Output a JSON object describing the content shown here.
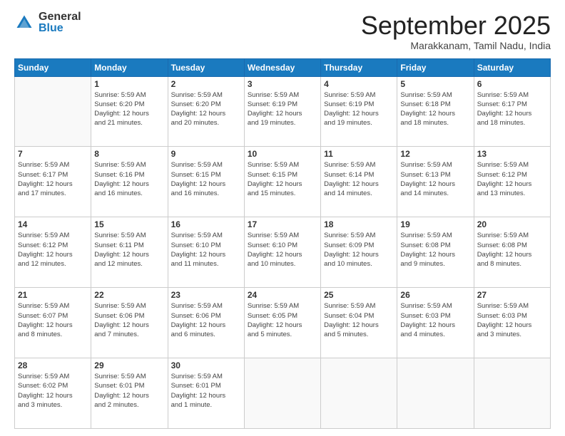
{
  "logo": {
    "general": "General",
    "blue": "Blue"
  },
  "header": {
    "month": "September 2025",
    "location": "Marakkanam, Tamil Nadu, India"
  },
  "weekdays": [
    "Sunday",
    "Monday",
    "Tuesday",
    "Wednesday",
    "Thursday",
    "Friday",
    "Saturday"
  ],
  "weeks": [
    [
      {
        "day": "",
        "info": ""
      },
      {
        "day": "1",
        "info": "Sunrise: 5:59 AM\nSunset: 6:20 PM\nDaylight: 12 hours\nand 21 minutes."
      },
      {
        "day": "2",
        "info": "Sunrise: 5:59 AM\nSunset: 6:20 PM\nDaylight: 12 hours\nand 20 minutes."
      },
      {
        "day": "3",
        "info": "Sunrise: 5:59 AM\nSunset: 6:19 PM\nDaylight: 12 hours\nand 19 minutes."
      },
      {
        "day": "4",
        "info": "Sunrise: 5:59 AM\nSunset: 6:19 PM\nDaylight: 12 hours\nand 19 minutes."
      },
      {
        "day": "5",
        "info": "Sunrise: 5:59 AM\nSunset: 6:18 PM\nDaylight: 12 hours\nand 18 minutes."
      },
      {
        "day": "6",
        "info": "Sunrise: 5:59 AM\nSunset: 6:17 PM\nDaylight: 12 hours\nand 18 minutes."
      }
    ],
    [
      {
        "day": "7",
        "info": "Sunrise: 5:59 AM\nSunset: 6:17 PM\nDaylight: 12 hours\nand 17 minutes."
      },
      {
        "day": "8",
        "info": "Sunrise: 5:59 AM\nSunset: 6:16 PM\nDaylight: 12 hours\nand 16 minutes."
      },
      {
        "day": "9",
        "info": "Sunrise: 5:59 AM\nSunset: 6:15 PM\nDaylight: 12 hours\nand 16 minutes."
      },
      {
        "day": "10",
        "info": "Sunrise: 5:59 AM\nSunset: 6:15 PM\nDaylight: 12 hours\nand 15 minutes."
      },
      {
        "day": "11",
        "info": "Sunrise: 5:59 AM\nSunset: 6:14 PM\nDaylight: 12 hours\nand 14 minutes."
      },
      {
        "day": "12",
        "info": "Sunrise: 5:59 AM\nSunset: 6:13 PM\nDaylight: 12 hours\nand 14 minutes."
      },
      {
        "day": "13",
        "info": "Sunrise: 5:59 AM\nSunset: 6:12 PM\nDaylight: 12 hours\nand 13 minutes."
      }
    ],
    [
      {
        "day": "14",
        "info": "Sunrise: 5:59 AM\nSunset: 6:12 PM\nDaylight: 12 hours\nand 12 minutes."
      },
      {
        "day": "15",
        "info": "Sunrise: 5:59 AM\nSunset: 6:11 PM\nDaylight: 12 hours\nand 12 minutes."
      },
      {
        "day": "16",
        "info": "Sunrise: 5:59 AM\nSunset: 6:10 PM\nDaylight: 12 hours\nand 11 minutes."
      },
      {
        "day": "17",
        "info": "Sunrise: 5:59 AM\nSunset: 6:10 PM\nDaylight: 12 hours\nand 10 minutes."
      },
      {
        "day": "18",
        "info": "Sunrise: 5:59 AM\nSunset: 6:09 PM\nDaylight: 12 hours\nand 10 minutes."
      },
      {
        "day": "19",
        "info": "Sunrise: 5:59 AM\nSunset: 6:08 PM\nDaylight: 12 hours\nand 9 minutes."
      },
      {
        "day": "20",
        "info": "Sunrise: 5:59 AM\nSunset: 6:08 PM\nDaylight: 12 hours\nand 8 minutes."
      }
    ],
    [
      {
        "day": "21",
        "info": "Sunrise: 5:59 AM\nSunset: 6:07 PM\nDaylight: 12 hours\nand 8 minutes."
      },
      {
        "day": "22",
        "info": "Sunrise: 5:59 AM\nSunset: 6:06 PM\nDaylight: 12 hours\nand 7 minutes."
      },
      {
        "day": "23",
        "info": "Sunrise: 5:59 AM\nSunset: 6:06 PM\nDaylight: 12 hours\nand 6 minutes."
      },
      {
        "day": "24",
        "info": "Sunrise: 5:59 AM\nSunset: 6:05 PM\nDaylight: 12 hours\nand 5 minutes."
      },
      {
        "day": "25",
        "info": "Sunrise: 5:59 AM\nSunset: 6:04 PM\nDaylight: 12 hours\nand 5 minutes."
      },
      {
        "day": "26",
        "info": "Sunrise: 5:59 AM\nSunset: 6:03 PM\nDaylight: 12 hours\nand 4 minutes."
      },
      {
        "day": "27",
        "info": "Sunrise: 5:59 AM\nSunset: 6:03 PM\nDaylight: 12 hours\nand 3 minutes."
      }
    ],
    [
      {
        "day": "28",
        "info": "Sunrise: 5:59 AM\nSunset: 6:02 PM\nDaylight: 12 hours\nand 3 minutes."
      },
      {
        "day": "29",
        "info": "Sunrise: 5:59 AM\nSunset: 6:01 PM\nDaylight: 12 hours\nand 2 minutes."
      },
      {
        "day": "30",
        "info": "Sunrise: 5:59 AM\nSunset: 6:01 PM\nDaylight: 12 hours\nand 1 minute."
      },
      {
        "day": "",
        "info": ""
      },
      {
        "day": "",
        "info": ""
      },
      {
        "day": "",
        "info": ""
      },
      {
        "day": "",
        "info": ""
      }
    ]
  ]
}
